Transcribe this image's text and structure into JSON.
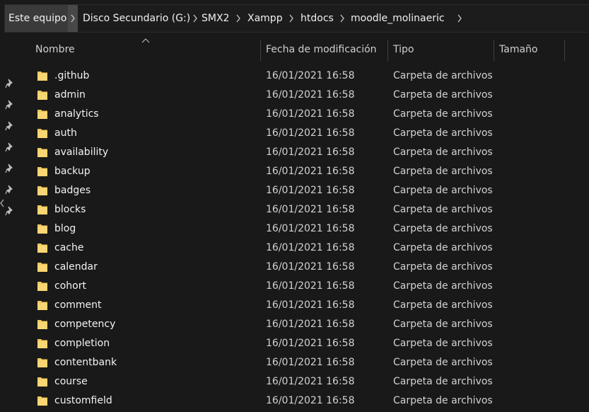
{
  "breadcrumb": {
    "items": [
      "Este equipo",
      "Disco Secundario (G:)",
      "SMX2",
      "Xampp",
      "htdocs",
      "moodle_molinaeric"
    ]
  },
  "columns": {
    "name": "Nombre",
    "date": "Fecha de modificación",
    "type": "Tipo",
    "size": "Tamaño"
  },
  "files": [
    {
      "name": ".github",
      "date": "16/01/2021 16:58",
      "type": "Carpeta de archivos",
      "icon": "folder-icon"
    },
    {
      "name": "admin",
      "date": "16/01/2021 16:58",
      "type": "Carpeta de archivos",
      "icon": "folder-icon"
    },
    {
      "name": "analytics",
      "date": "16/01/2021 16:58",
      "type": "Carpeta de archivos",
      "icon": "folder-icon"
    },
    {
      "name": "auth",
      "date": "16/01/2021 16:58",
      "type": "Carpeta de archivos",
      "icon": "folder-icon"
    },
    {
      "name": "availability",
      "date": "16/01/2021 16:58",
      "type": "Carpeta de archivos",
      "icon": "folder-icon"
    },
    {
      "name": "backup",
      "date": "16/01/2021 16:58",
      "type": "Carpeta de archivos",
      "icon": "folder-icon"
    },
    {
      "name": "badges",
      "date": "16/01/2021 16:58",
      "type": "Carpeta de archivos",
      "icon": "folder-icon"
    },
    {
      "name": "blocks",
      "date": "16/01/2021 16:58",
      "type": "Carpeta de archivos",
      "icon": "folder-icon"
    },
    {
      "name": "blog",
      "date": "16/01/2021 16:58",
      "type": "Carpeta de archivos",
      "icon": "folder-icon"
    },
    {
      "name": "cache",
      "date": "16/01/2021 16:58",
      "type": "Carpeta de archivos",
      "icon": "folder-icon"
    },
    {
      "name": "calendar",
      "date": "16/01/2021 16:58",
      "type": "Carpeta de archivos",
      "icon": "folder-icon"
    },
    {
      "name": "cohort",
      "date": "16/01/2021 16:58",
      "type": "Carpeta de archivos",
      "icon": "folder-icon"
    },
    {
      "name": "comment",
      "date": "16/01/2021 16:58",
      "type": "Carpeta de archivos",
      "icon": "folder-icon"
    },
    {
      "name": "competency",
      "date": "16/01/2021 16:58",
      "type": "Carpeta de archivos",
      "icon": "folder-icon"
    },
    {
      "name": "completion",
      "date": "16/01/2021 16:58",
      "type": "Carpeta de archivos",
      "icon": "folder-icon"
    },
    {
      "name": "contentbank",
      "date": "16/01/2021 16:58",
      "type": "Carpeta de archivos",
      "icon": "folder-icon"
    },
    {
      "name": "course",
      "date": "16/01/2021 16:58",
      "type": "Carpeta de archivos",
      "icon": "folder-icon"
    },
    {
      "name": "customfield",
      "date": "16/01/2021 16:58",
      "type": "Carpeta de archivos",
      "icon": "folder-icon"
    }
  ],
  "sort": {
    "column": "name",
    "direction": "ascending",
    "icon": "sort-ascending-icon"
  },
  "colors": {
    "background": "#191919",
    "folder": "#f4c95d",
    "text": "#f2f2f2",
    "muted_text": "#d2d2d2"
  }
}
